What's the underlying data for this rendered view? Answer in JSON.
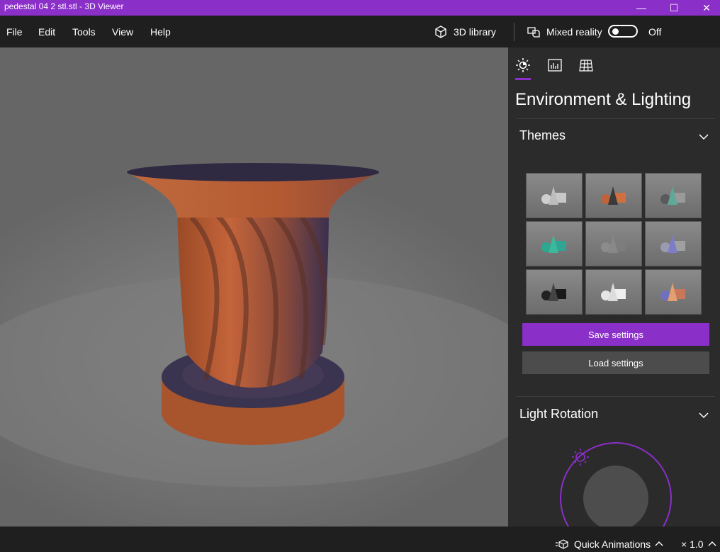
{
  "window": {
    "title": "pedestal 04 2 stl.stl - 3D Viewer",
    "minimize_glyph": "—",
    "maximize_glyph": "☐",
    "close_glyph": "✕"
  },
  "menu": {
    "items": [
      "File",
      "Edit",
      "Tools",
      "View",
      "Help"
    ]
  },
  "toolbar": {
    "library_label": "3D library",
    "mixed_reality_label": "Mixed reality",
    "toggle_state": "Off"
  },
  "panel": {
    "tabs": [
      {
        "icon": "sun-icon",
        "selected": true
      },
      {
        "icon": "stats-icon",
        "selected": false
      },
      {
        "icon": "grid-icon",
        "selected": false
      }
    ],
    "heading": "Environment & Lighting",
    "themes_title": "Themes",
    "themes": [
      {
        "name": "theme-default",
        "colors": [
          "#cfcfcf",
          "#bdbdbd",
          "#c8c8c8"
        ]
      },
      {
        "name": "theme-warm",
        "colors": [
          "#c0623a",
          "#3a3a3a",
          "#d07040"
        ]
      },
      {
        "name": "theme-teal",
        "colors": [
          "#5a5a5a",
          "#5fa89a",
          "#9a9a9a"
        ]
      },
      {
        "name": "theme-green",
        "colors": [
          "#2aa890",
          "#3cb89c",
          "#2fa592"
        ]
      },
      {
        "name": "theme-grey",
        "colors": [
          "#8c8c8c",
          "#888888",
          "#7c7c7c"
        ]
      },
      {
        "name": "theme-violet",
        "colors": [
          "#9a9ab0",
          "#7c7cc8",
          "#a0a0a0"
        ]
      },
      {
        "name": "theme-dark",
        "colors": [
          "#222222",
          "#444444",
          "#1a1a1a"
        ]
      },
      {
        "name": "theme-light",
        "colors": [
          "#e6e6e6",
          "#dcdcdc",
          "#efefef"
        ]
      },
      {
        "name": "theme-sunset",
        "colors": [
          "#7070c0",
          "#e0a070",
          "#c87858"
        ]
      }
    ],
    "save_label": "Save settings",
    "load_label": "Load settings",
    "light_rotation_title": "Light Rotation"
  },
  "status": {
    "quick_animations_label": "Quick Animations",
    "speed_label": "× 1.0"
  },
  "colors": {
    "accent": "#8b2fc9",
    "model": "#b8582e"
  }
}
